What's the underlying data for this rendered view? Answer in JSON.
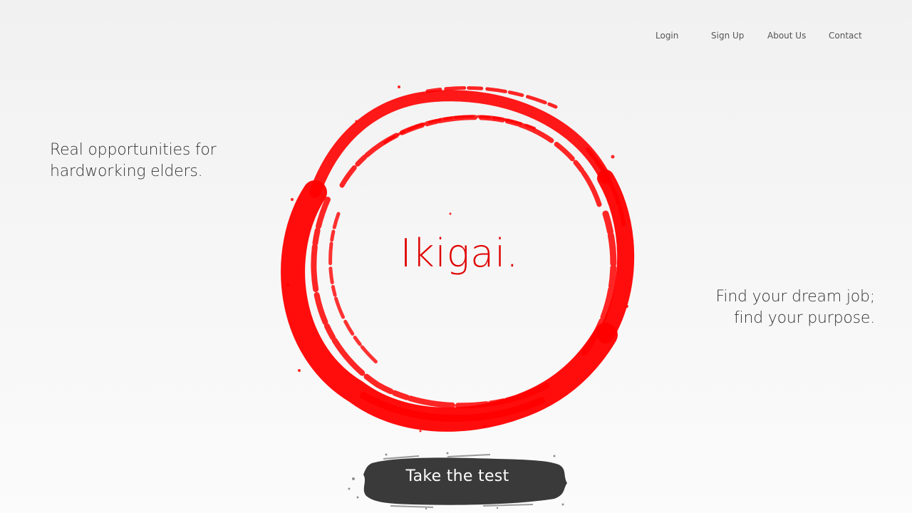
{
  "nav": {
    "login": "Login",
    "signup": "Sign Up",
    "about": "About Us",
    "contact": "Contact"
  },
  "hero": {
    "tagline_left": [
      "Real opportunities for",
      "hardworking elders."
    ],
    "brand": "Ikigai.",
    "tagline_right": [
      "Find your dream job;",
      "find your purpose."
    ],
    "cta_label": "Take the test"
  },
  "colors": {
    "accent": "#ff0000",
    "brand_text": "#e00000",
    "cta_background": "#3a3a3a",
    "text": "#333333"
  },
  "icons": {
    "enso": "ink-brush-circle",
    "cta_background": "ink-brush-stroke"
  }
}
